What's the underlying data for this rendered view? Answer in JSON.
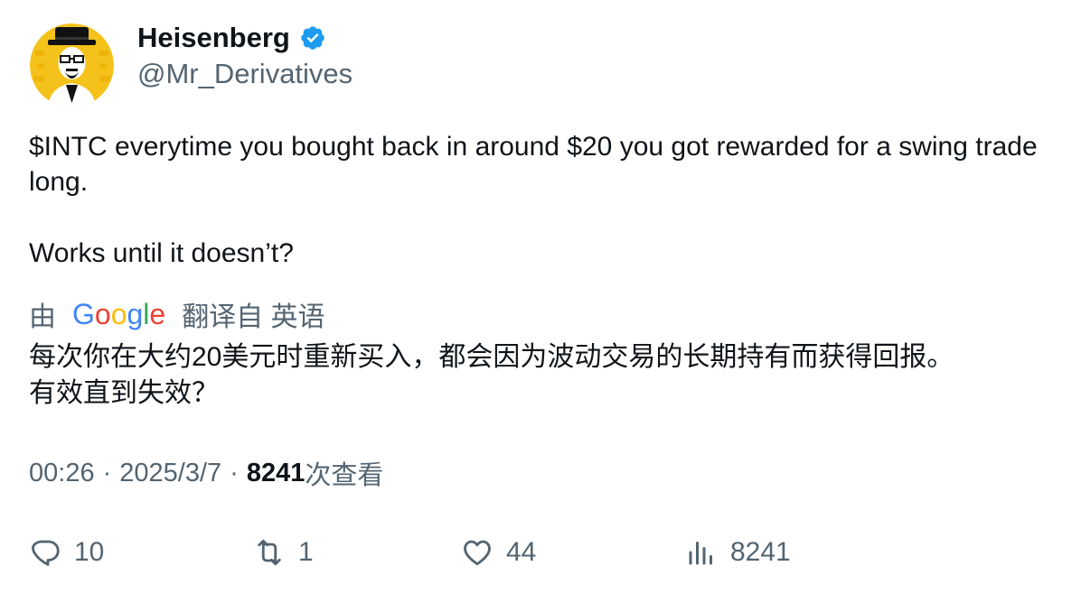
{
  "author": {
    "name": "Heisenberg",
    "handle": "@Mr_Derivatives",
    "verified": true,
    "avatar_bg": "#f4c21a",
    "verified_color": "#1d9bf0"
  },
  "tweet": {
    "paragraph_1": "$INTC everytime you bought back in around $20 you got rewarded for a swing trade long.",
    "paragraph_2": "Works until it doesn’t?"
  },
  "translation": {
    "by_prefix": "由",
    "provider": "Google",
    "suffix": "翻译自 英语",
    "line_1": "每次你在大约20美元时重新买入，都会因为波动交易的长期持有而获得回报。",
    "line_2": "有效直到失效？"
  },
  "meta": {
    "time": "00:26",
    "separator_1": "·",
    "date": "2025/3/7",
    "separator_2": "·",
    "views_count": "8241",
    "views_label": "次查看"
  },
  "actions": {
    "replies": "10",
    "retweets": "1",
    "likes": "44",
    "views": "8241"
  }
}
